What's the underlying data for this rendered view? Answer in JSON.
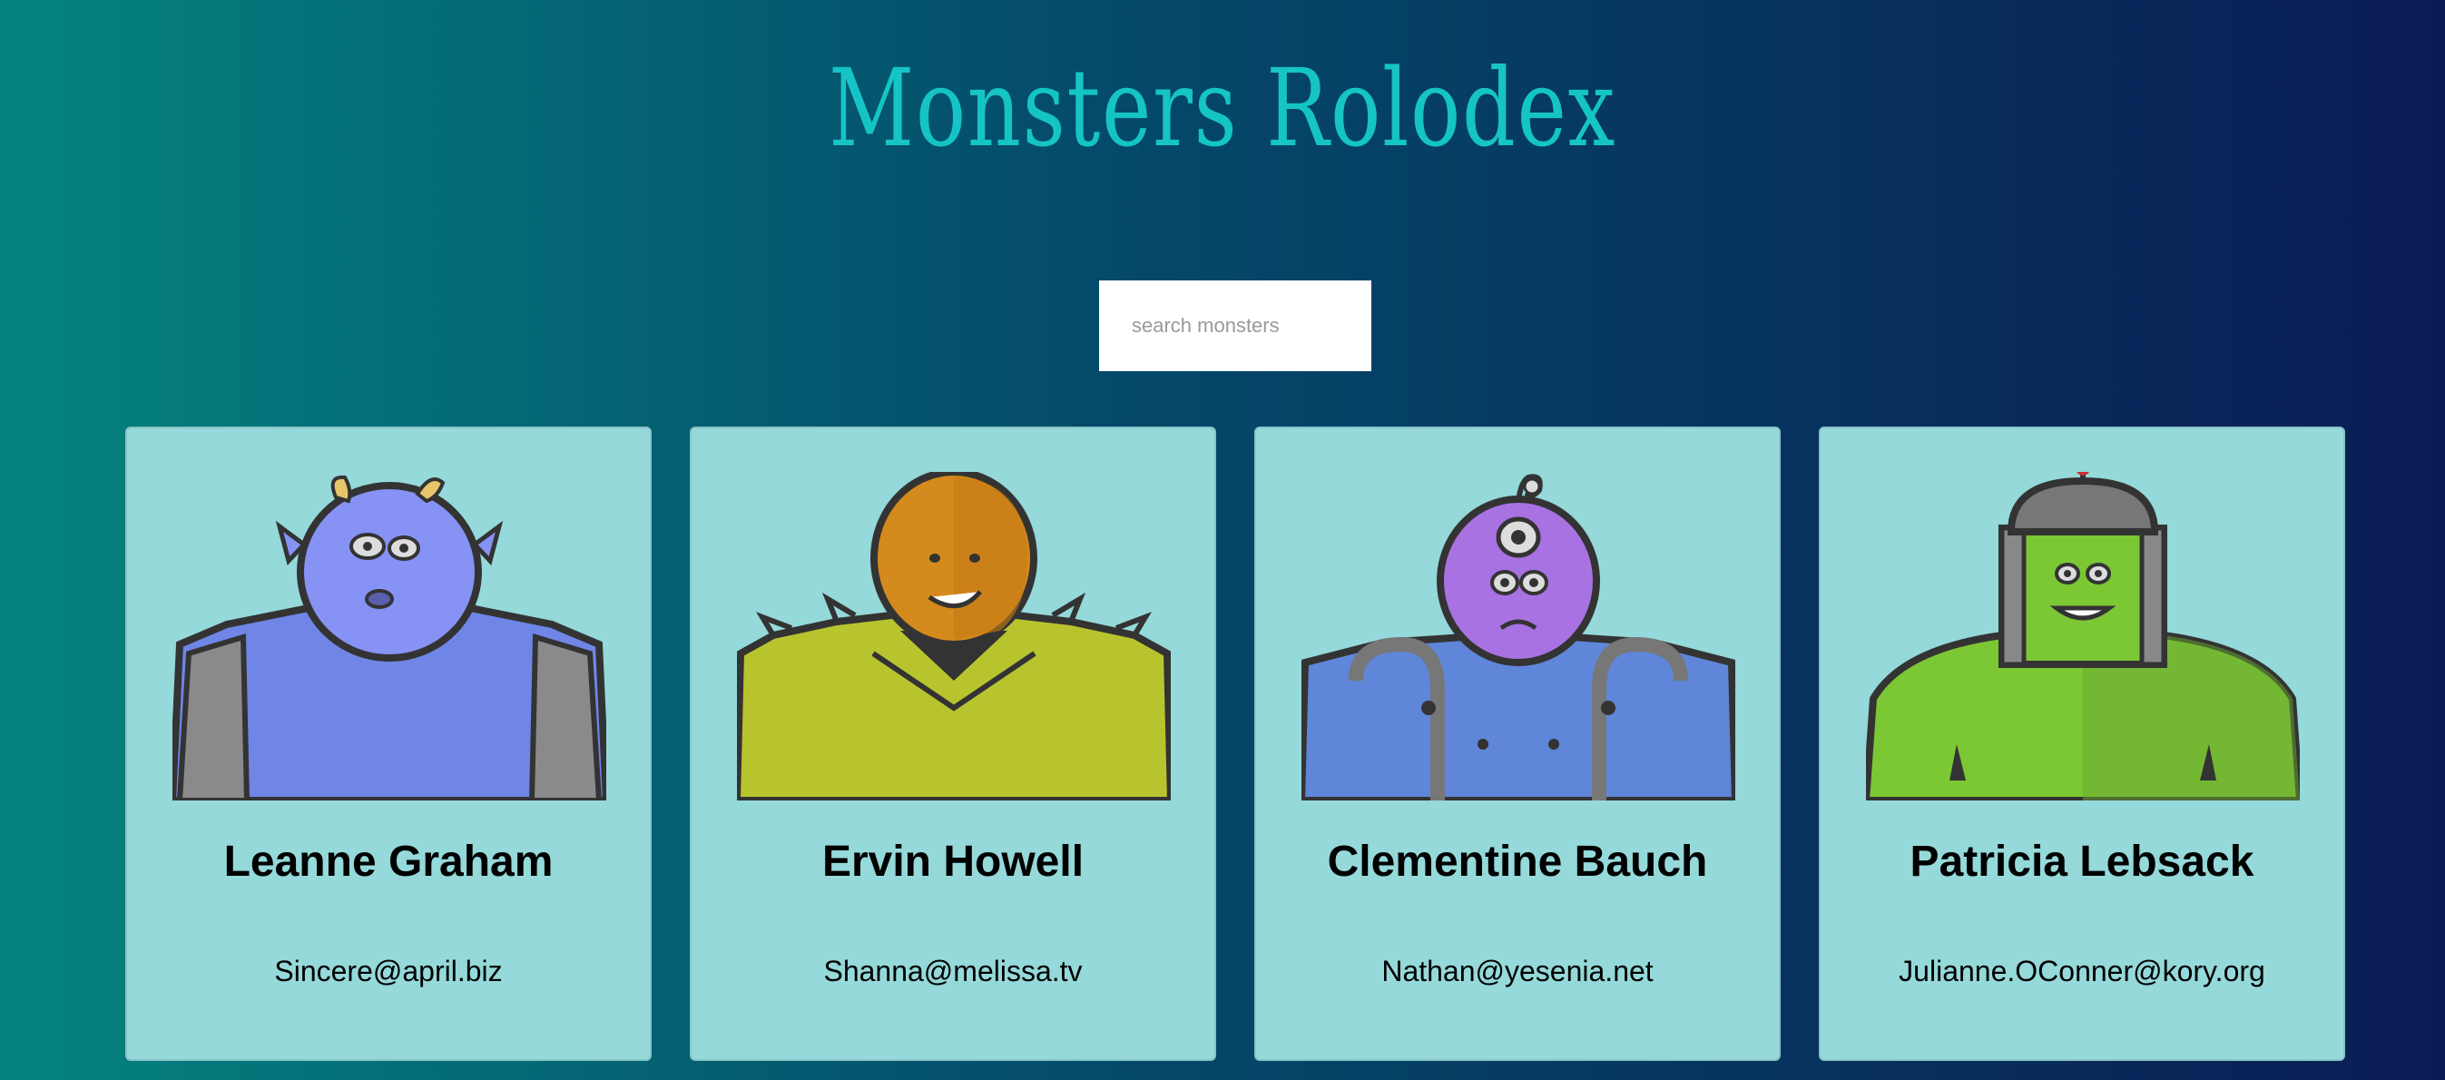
{
  "app": {
    "title": "Monsters Rolodex"
  },
  "search": {
    "placeholder": "search monsters",
    "value": ""
  },
  "monsters": [
    {
      "name": "Leanne Graham",
      "email": "Sincere@april.biz",
      "icon": "blue-horned-monster",
      "color": "#7f8ff0"
    },
    {
      "name": "Ervin Howell",
      "email": "Shanna@melissa.tv",
      "icon": "orange-spiky-monster",
      "color": "#d98a1e"
    },
    {
      "name": "Clementine Bauch",
      "email": "Nathan@yesenia.net",
      "icon": "purple-cyclops-monster",
      "color": "#a66ee0"
    },
    {
      "name": "Patricia Lebsack",
      "email": "Julianne.OConner@kory.org",
      "icon": "green-robot-monster",
      "color": "#7ccc2e"
    }
  ]
}
